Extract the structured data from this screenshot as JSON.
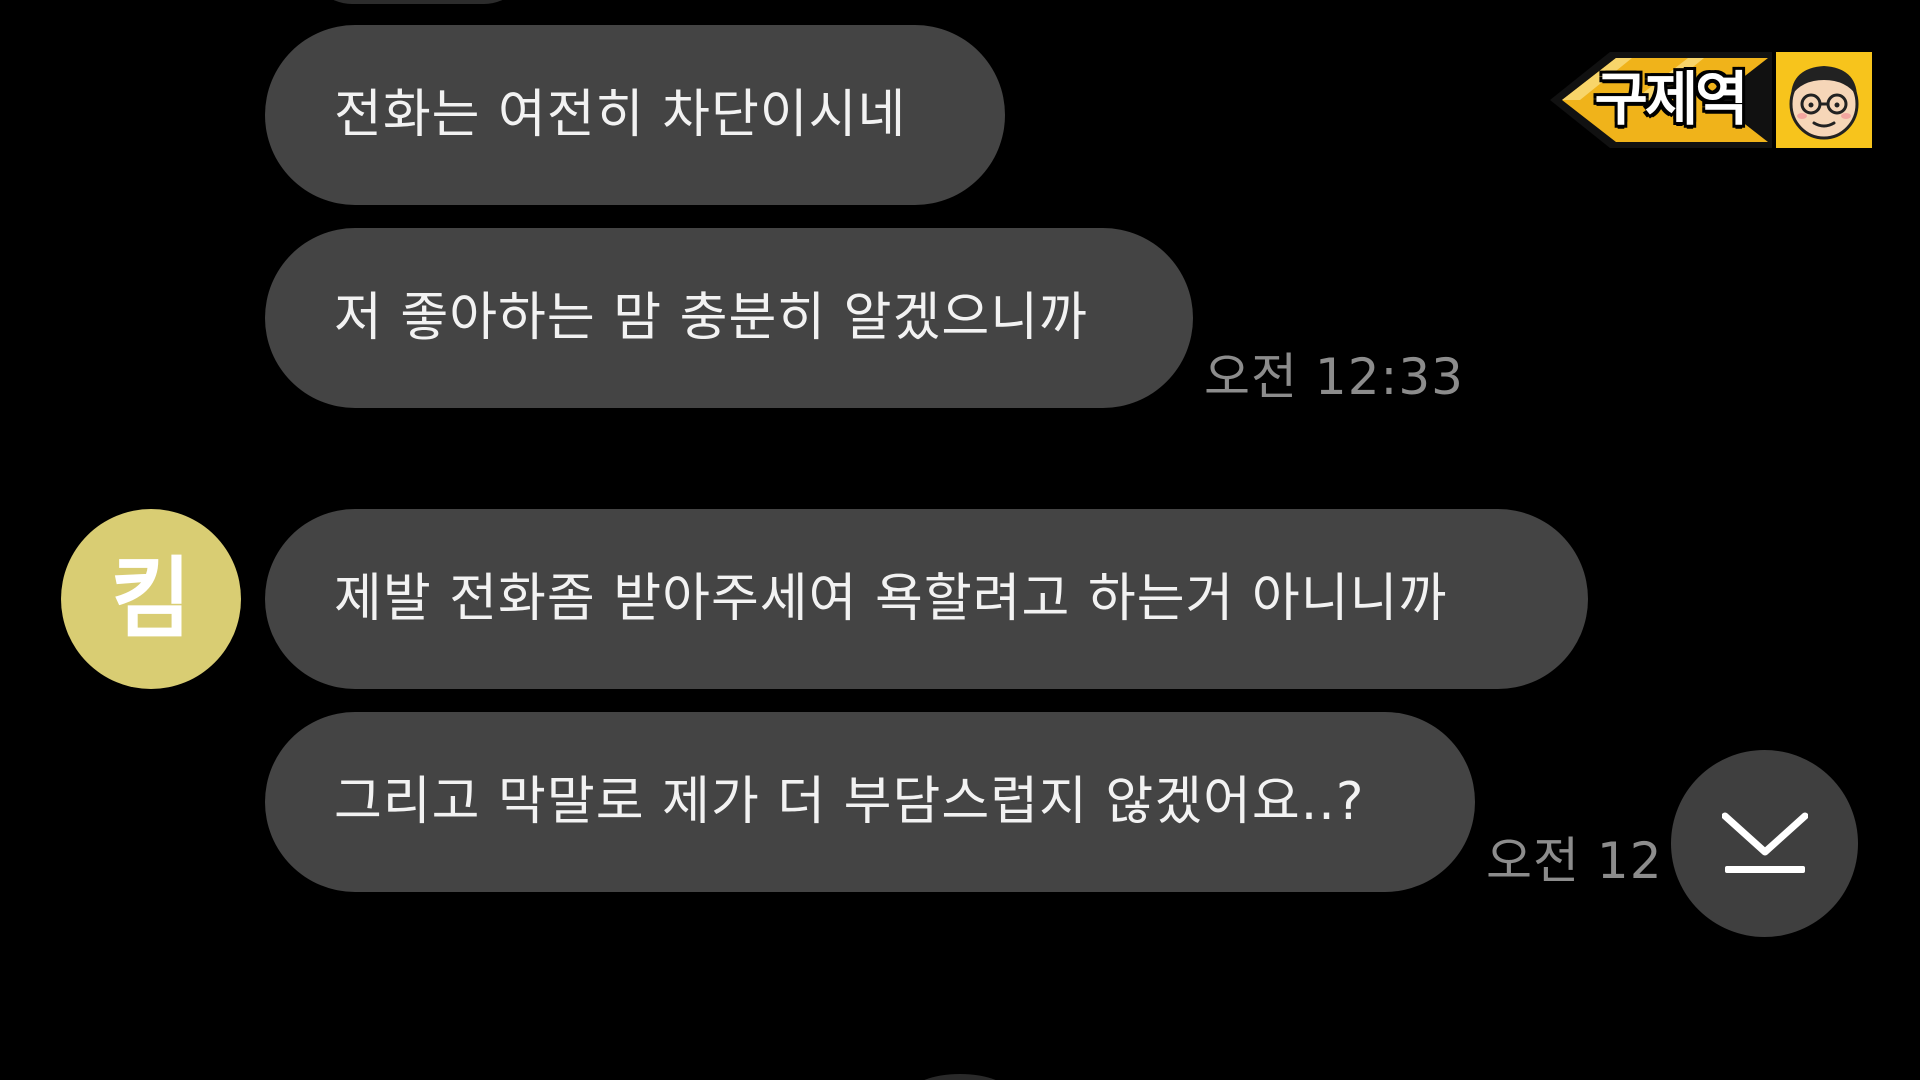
{
  "chat": {
    "messages": [
      {
        "text": "전화는 여전히 차단이시네"
      },
      {
        "text": "저 좋아하는 맘 충분히 알겠으니까",
        "time": "오전 12:33"
      },
      {
        "text": "제발 전화좀 받아주세여 욕할려고 하는거 아니니까"
      },
      {
        "text": "그리고 막말로 제가 더 부담스럽지 않겠어요..?",
        "time": "오전 12"
      }
    ],
    "sender_avatar": {
      "initial": "킴",
      "color": "#d9cd73"
    }
  },
  "controls": {
    "scroll_down_icon": "chevron-down-icon"
  },
  "watermark": {
    "channel_name": "구제역",
    "face_icon": "cartoon-face-with-glasses-icon",
    "accent_color": "#f7c41c"
  },
  "colors": {
    "background": "#000000",
    "bubble": "#444444",
    "timestamp": "#8c8c8c"
  }
}
